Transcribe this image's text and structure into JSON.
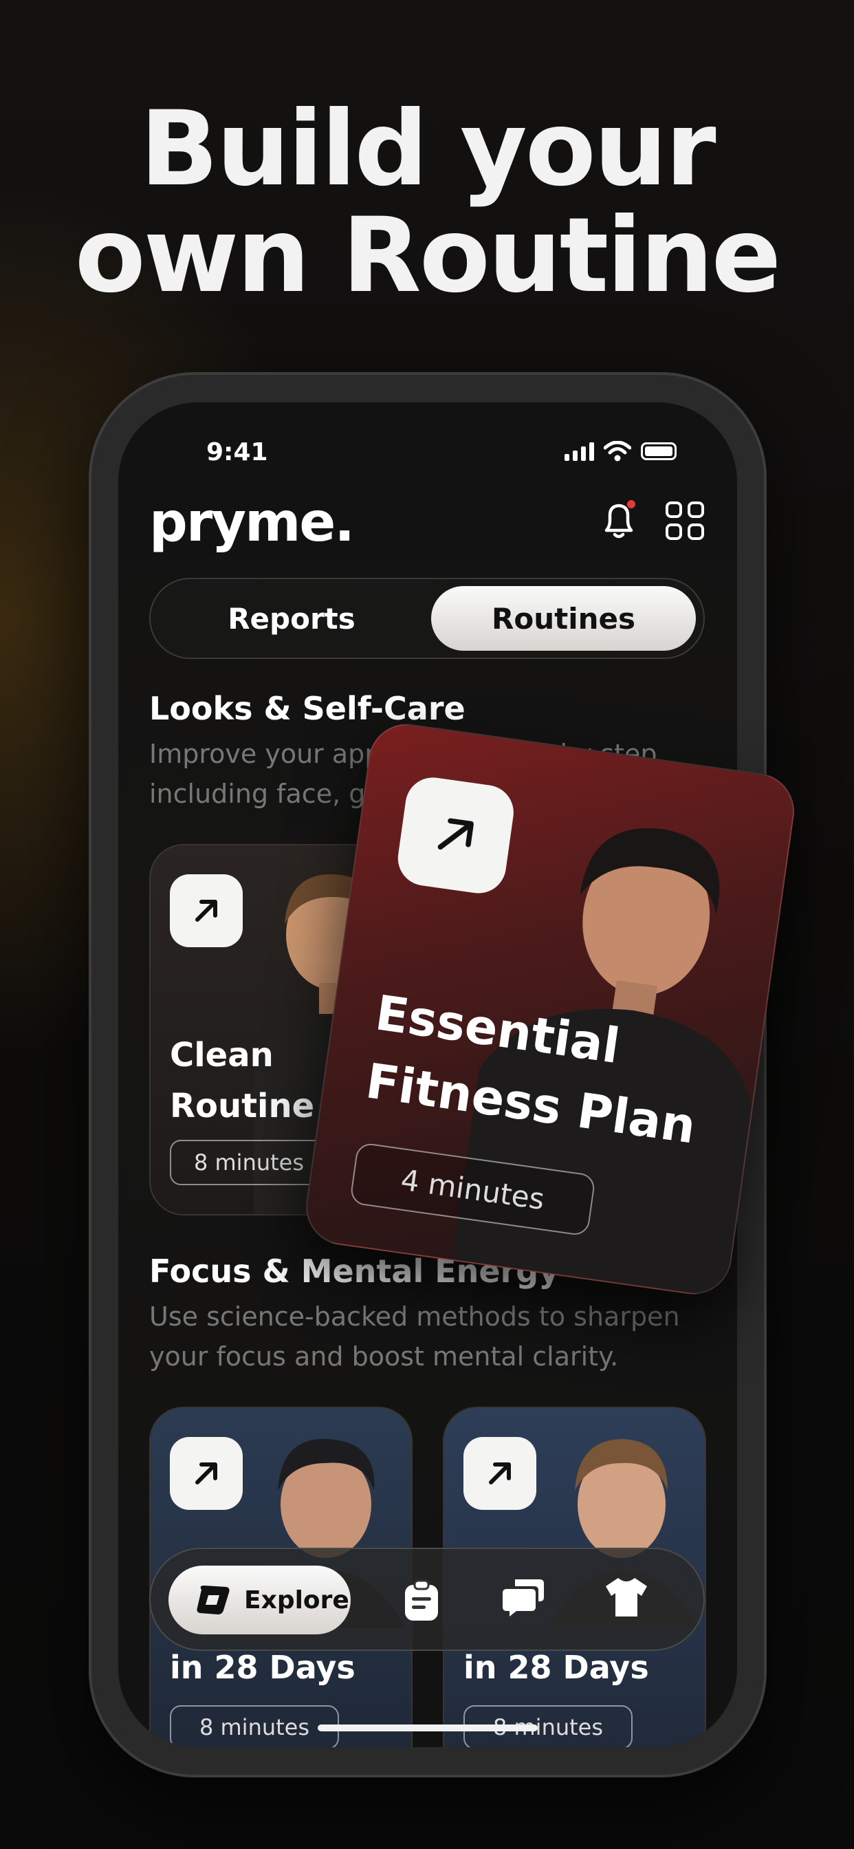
{
  "headline": {
    "line1": "Build your",
    "line2": "own Routine"
  },
  "status_bar": {
    "time": "9:41"
  },
  "app": {
    "logo": "pryme."
  },
  "tabs": {
    "reports": "Reports",
    "routines": "Routines"
  },
  "sections": [
    {
      "title": "Looks & Self-Care",
      "description": "Improve your appearance step by step, including face, grooming and more."
    },
    {
      "title": "Focus & Mental Energy",
      "description": "Use science-backed methods to sharpen your focus and boost mental clarity."
    }
  ],
  "cards": {
    "clean_routine": {
      "title_line1": "Clean",
      "title_line2": "Routine",
      "duration": "8 minutes"
    },
    "featured": {
      "title_line1": "Essential",
      "title_line2": "Fitness Plan",
      "duration": "4 minutes"
    },
    "focus_left": {
      "title": "in 28 Days",
      "duration": "8 minutes"
    },
    "focus_right": {
      "title": "in 28 Days",
      "duration": "8 minutes"
    }
  },
  "tabbar": {
    "explore": "Explore"
  },
  "icons": [
    "bell-icon",
    "grid-icon",
    "arrow-up-right-icon",
    "explore-icon",
    "clipboard-icon",
    "chat-icon",
    "shirt-icon"
  ],
  "colors": {
    "accent_red": "#e53935",
    "featured_bg": "#7a1f1f"
  }
}
